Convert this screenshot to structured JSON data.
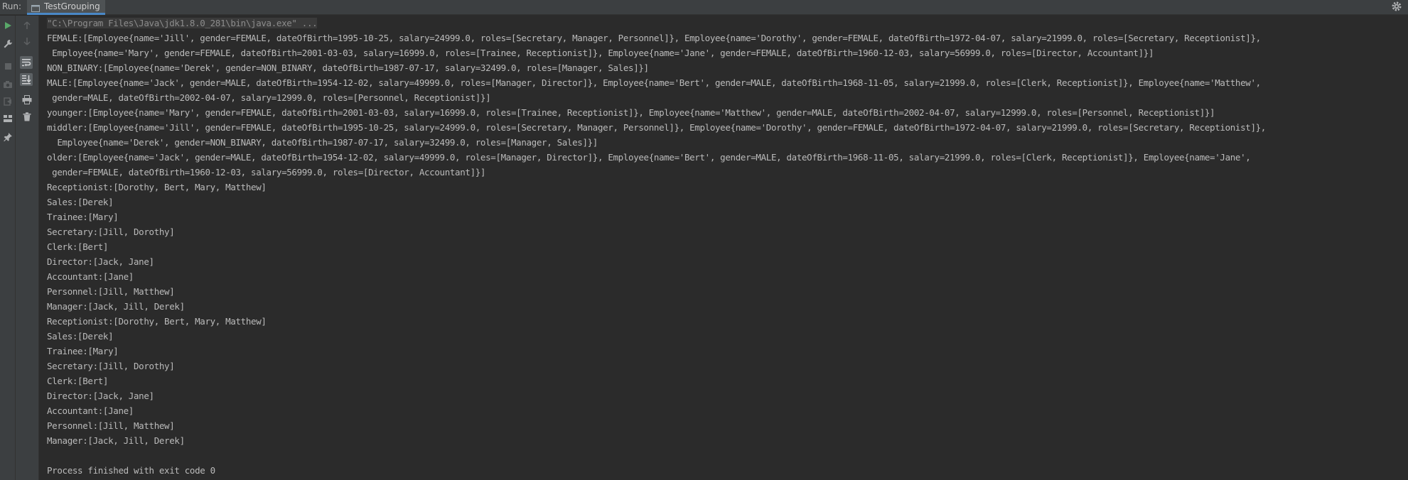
{
  "tabbar": {
    "run_label": "Run:",
    "tab_label": "TestGrouping"
  },
  "icons": {
    "run": "play-icon",
    "wrench": "wrench-icon",
    "stop": "stop-icon",
    "camera": "camera-icon",
    "exit": "exit-icon",
    "layout": "layout-icon",
    "pin": "pin-icon",
    "up": "arrow-up-icon",
    "down": "arrow-down-icon",
    "wrap": "soft-wrap-icon",
    "scroll": "scroll-to-end-icon",
    "print": "print-icon",
    "trash": "trash-icon",
    "settings": "gear-icon"
  },
  "colors": {
    "background": "#2b2b2b",
    "toolbar": "#3c3f41",
    "text": "#bbbbbb",
    "run_green": "#59a869",
    "tab_accent": "#4a88c7"
  },
  "console": {
    "lines": [
      "\"C:\\Program Files\\Java\\jdk1.8.0_281\\bin\\java.exe\" ...",
      "FEMALE:[Employee{name='Jill', gender=FEMALE, dateOfBirth=1995-10-25, salary=24999.0, roles=[Secretary, Manager, Personnel]}, Employee{name='Dorothy', gender=FEMALE, dateOfBirth=1972-04-07, salary=21999.0, roles=[Secretary, Receptionist]},",
      " Employee{name='Mary', gender=FEMALE, dateOfBirth=2001-03-03, salary=16999.0, roles=[Trainee, Receptionist]}, Employee{name='Jane', gender=FEMALE, dateOfBirth=1960-12-03, salary=56999.0, roles=[Director, Accountant]}]",
      "NON_BINARY:[Employee{name='Derek', gender=NON_BINARY, dateOfBirth=1987-07-17, salary=32499.0, roles=[Manager, Sales]}]",
      "MALE:[Employee{name='Jack', gender=MALE, dateOfBirth=1954-12-02, salary=49999.0, roles=[Manager, Director]}, Employee{name='Bert', gender=MALE, dateOfBirth=1968-11-05, salary=21999.0, roles=[Clerk, Receptionist]}, Employee{name='Matthew',",
      " gender=MALE, dateOfBirth=2002-04-07, salary=12999.0, roles=[Personnel, Receptionist]}]",
      "younger:[Employee{name='Mary', gender=FEMALE, dateOfBirth=2001-03-03, salary=16999.0, roles=[Trainee, Receptionist]}, Employee{name='Matthew', gender=MALE, dateOfBirth=2002-04-07, salary=12999.0, roles=[Personnel, Receptionist]}]",
      "middler:[Employee{name='Jill', gender=FEMALE, dateOfBirth=1995-10-25, salary=24999.0, roles=[Secretary, Manager, Personnel]}, Employee{name='Dorothy', gender=FEMALE, dateOfBirth=1972-04-07, salary=21999.0, roles=[Secretary, Receptionist]},",
      "  Employee{name='Derek', gender=NON_BINARY, dateOfBirth=1987-07-17, salary=32499.0, roles=[Manager, Sales]}]",
      "older:[Employee{name='Jack', gender=MALE, dateOfBirth=1954-12-02, salary=49999.0, roles=[Manager, Director]}, Employee{name='Bert', gender=MALE, dateOfBirth=1968-11-05, salary=21999.0, roles=[Clerk, Receptionist]}, Employee{name='Jane',",
      " gender=FEMALE, dateOfBirth=1960-12-03, salary=56999.0, roles=[Director, Accountant]}]",
      "Receptionist:[Dorothy, Bert, Mary, Matthew]",
      "Sales:[Derek]",
      "Trainee:[Mary]",
      "Secretary:[Jill, Dorothy]",
      "Clerk:[Bert]",
      "Director:[Jack, Jane]",
      "Accountant:[Jane]",
      "Personnel:[Jill, Matthew]",
      "Manager:[Jack, Jill, Derek]",
      "Receptionist:[Dorothy, Bert, Mary, Matthew]",
      "Sales:[Derek]",
      "Trainee:[Mary]",
      "Secretary:[Jill, Dorothy]",
      "Clerk:[Bert]",
      "Director:[Jack, Jane]",
      "Accountant:[Jane]",
      "Personnel:[Jill, Matthew]",
      "Manager:[Jack, Jill, Derek]",
      "",
      "Process finished with exit code 0"
    ]
  }
}
